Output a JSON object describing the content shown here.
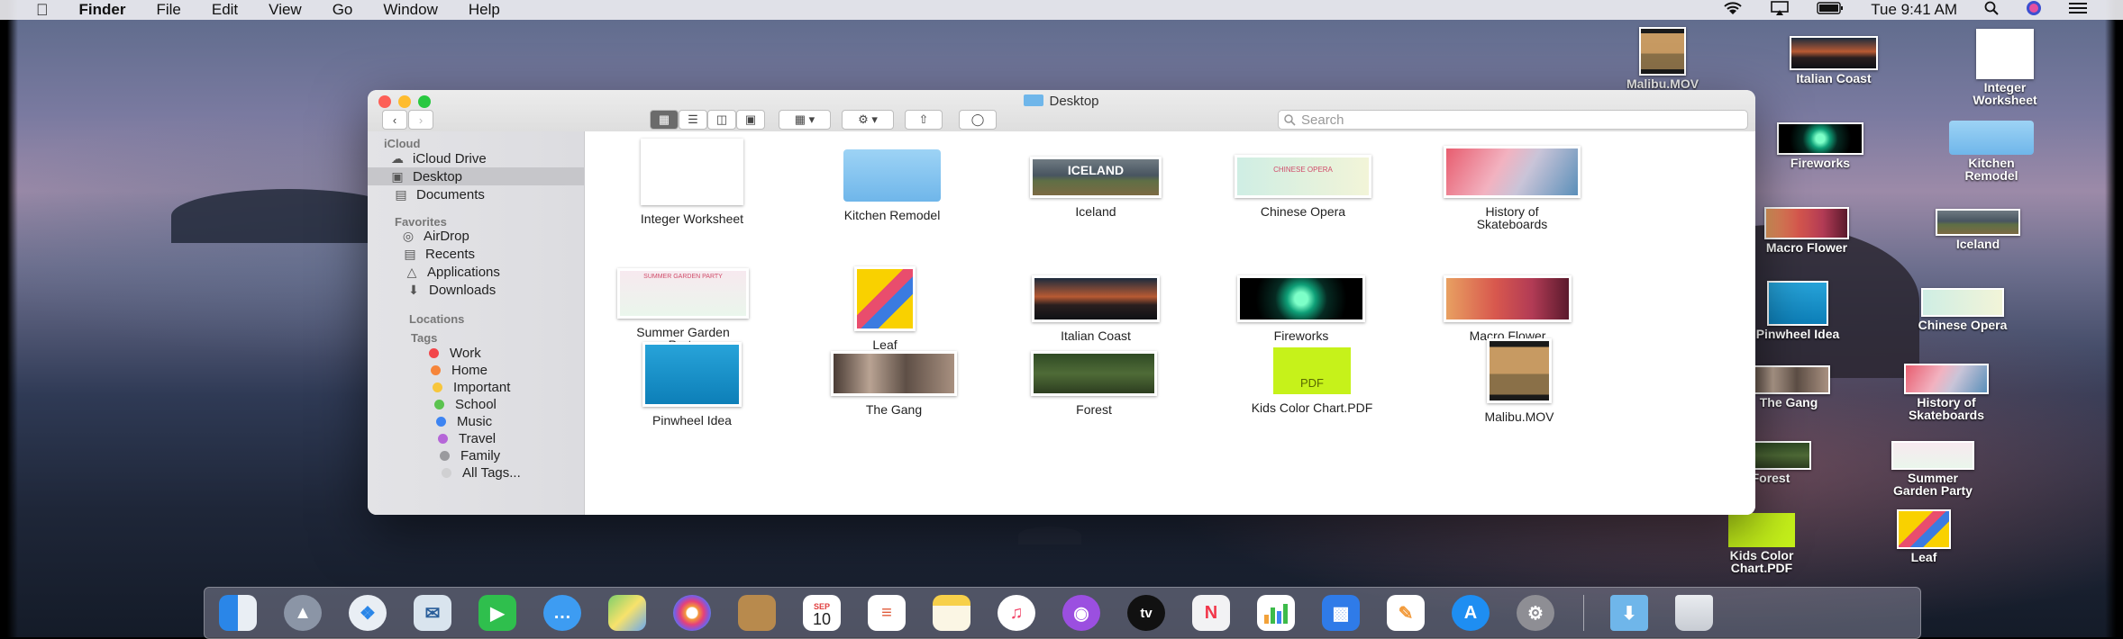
{
  "menubar": {
    "app": "Finder",
    "items": [
      "File",
      "Edit",
      "View",
      "Go",
      "Window",
      "Help"
    ],
    "clock": "Tue 9:41 AM"
  },
  "window": {
    "title": "Desktop",
    "search_placeholder": "Search"
  },
  "sidebar": {
    "icloud_header": "iCloud",
    "icloud": [
      "iCloud Drive",
      "Desktop",
      "Documents"
    ],
    "favorites_header": "Favorites",
    "favorites": [
      "AirDrop",
      "Recents",
      "Applications",
      "Downloads"
    ],
    "locations_header": "Locations",
    "tags_header": "Tags",
    "tags": [
      {
        "name": "Work",
        "color": "#f2464a"
      },
      {
        "name": "Home",
        "color": "#f6853a"
      },
      {
        "name": "Important",
        "color": "#f7c63c"
      },
      {
        "name": "School",
        "color": "#5bc34f"
      },
      {
        "name": "Music",
        "color": "#3d84f2"
      },
      {
        "name": "Travel",
        "color": "#b566d8"
      },
      {
        "name": "Family",
        "color": "#9a9a9e"
      },
      {
        "name": "All Tags...",
        "color": "#d0d0d2"
      }
    ]
  },
  "files": [
    "Integer Worksheet",
    "Kitchen Remodel",
    "Iceland",
    "Chinese Opera",
    "History of\nSkateboards",
    "Summer Garden\nParty",
    "Leaf",
    "Italian Coast",
    "Fireworks",
    "Macro Flower",
    "Pinwheel Idea",
    "The Gang",
    "Forest",
    "Kids Color Chart.PDF",
    "Malibu.MOV"
  ],
  "thumb_text": {
    "iceland": "ICELAND",
    "pdf": "PDF",
    "opera": "CHINESE OPERA",
    "summer": "SUMMER GARDEN PARTY"
  },
  "desktop_icons": [
    "Malibu.MOV",
    "Italian Coast",
    "Integer\nWorksheet",
    "Fireworks",
    "Kitchen\nRemodel",
    "Macro Flower",
    "Iceland",
    "Pinwheel Idea",
    "Chinese Opera",
    "The Gang",
    "History of\nSkateboards",
    "Forest",
    "Summer\nGarden Party",
    "Kids Color\nChart.PDF",
    "Leaf"
  ],
  "dock": {
    "calendar_month": "SEP",
    "calendar_day": "10",
    "tv_label": "tv"
  }
}
